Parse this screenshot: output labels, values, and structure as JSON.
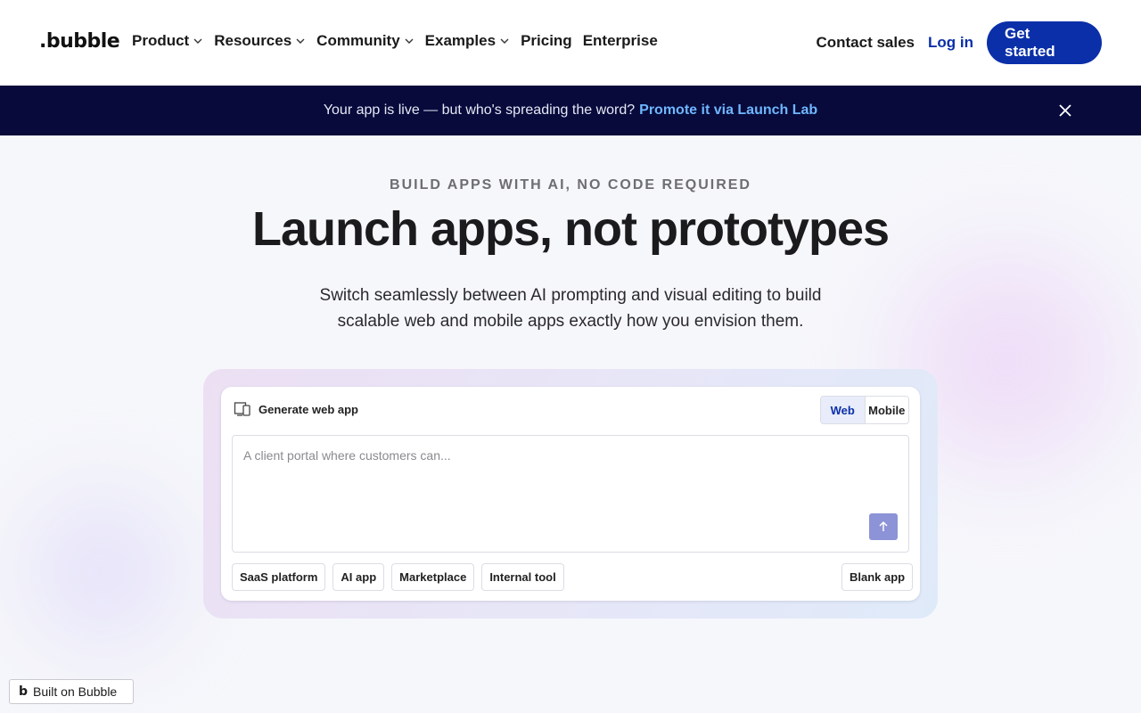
{
  "header": {
    "logo": ".bubble",
    "nav": [
      {
        "label": "Product",
        "dropdown": true
      },
      {
        "label": "Resources",
        "dropdown": true
      },
      {
        "label": "Community",
        "dropdown": true
      },
      {
        "label": "Examples",
        "dropdown": true
      },
      {
        "label": "Pricing",
        "dropdown": false
      },
      {
        "label": "Enterprise",
        "dropdown": false
      }
    ],
    "contact_sales": "Contact sales",
    "login": "Log in",
    "get_started": "Get started"
  },
  "banner": {
    "text": "Your app is live — but who's spreading the word?",
    "link": "Promote it via Launch Lab",
    "close_icon": "close-icon"
  },
  "hero": {
    "eyebrow": "BUILD APPS WITH AI, NO CODE REQUIRED",
    "title": "Launch apps, not prototypes",
    "subtitle": "Switch seamlessly between AI prompting and visual editing to build scalable web and mobile apps exactly how you envision them."
  },
  "generator": {
    "heading": "Generate web app",
    "heading_icon": "device-icon",
    "toggle": {
      "web": "Web",
      "mobile": "Mobile",
      "selected": "Web"
    },
    "prompt_placeholder": "A client portal where customers can...",
    "send_icon": "arrow-up-icon",
    "suggestions": [
      "SaaS platform",
      "AI app",
      "Marketplace",
      "Internal tool"
    ],
    "blank_app": "Blank app"
  },
  "badge": {
    "logo": "b",
    "label": "Built on Bubble"
  },
  "colors": {
    "brand": "#0a2fa8",
    "banner_bg": "#070a3b",
    "link": "#6fb6ff",
    "send_button": "#8c93d6"
  }
}
